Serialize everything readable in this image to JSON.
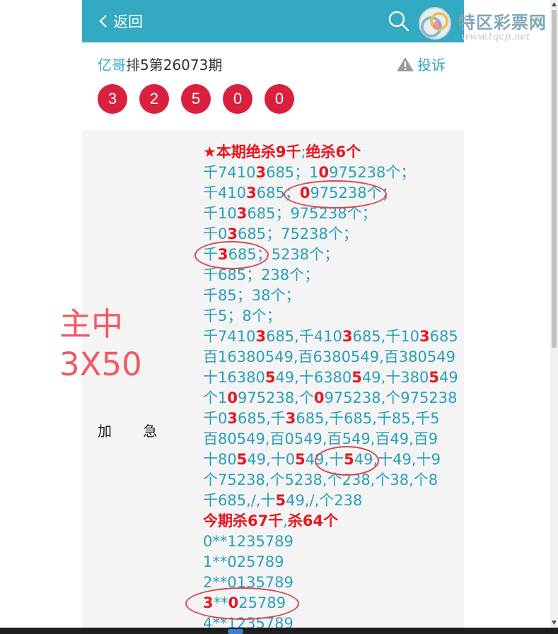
{
  "header": {
    "back_label": "返回",
    "logo_text": "特区彩票网",
    "logo_url": "www.tqcp.net",
    "bar_color": "#33a9c2"
  },
  "title": {
    "author": "亿哥",
    "text": "排5第26073期",
    "complain_label": "投诉"
  },
  "result_balls": [
    "3",
    "2",
    "5",
    "0",
    "0"
  ],
  "side": {
    "big_hit_line1": "主中",
    "big_hit_line2": "3X50",
    "urgent": "加 急"
  },
  "post_lines": [
    [
      {
        "t": "★本期绝杀9千",
        "s": "hd"
      },
      {
        "t": ";",
        "s": ""
      },
      {
        "t": "绝杀6个",
        "s": "hd"
      }
    ],
    [
      {
        "t": "千7410",
        "s": ""
      },
      {
        "t": "3",
        "s": "hl"
      },
      {
        "t": "685；1",
        "s": ""
      },
      {
        "t": "0",
        "s": "hl"
      },
      {
        "t": "975238个；",
        "s": ""
      }
    ],
    [
      {
        "t": "千410",
        "s": ""
      },
      {
        "t": "3",
        "s": "hl"
      },
      {
        "t": "685；",
        "s": ""
      },
      {
        "t": "0",
        "s": "hl"
      },
      {
        "t": "975238个；",
        "s": ""
      }
    ],
    [
      {
        "t": "千10",
        "s": ""
      },
      {
        "t": "3",
        "s": "hl"
      },
      {
        "t": "685；975238个；",
        "s": ""
      }
    ],
    [
      {
        "t": "千0",
        "s": ""
      },
      {
        "t": "3",
        "s": "hl"
      },
      {
        "t": "685；75238个；",
        "s": ""
      }
    ],
    [
      {
        "t": "千",
        "s": ""
      },
      {
        "t": "3",
        "s": "hl"
      },
      {
        "t": "685；5238个；",
        "s": ""
      }
    ],
    [
      {
        "t": "千685；238个；",
        "s": ""
      }
    ],
    [
      {
        "t": "千85；38个；",
        "s": ""
      }
    ],
    [
      {
        "t": "千5；8个；",
        "s": ""
      }
    ],
    [
      {
        "t": "千7410",
        "s": ""
      },
      {
        "t": "3",
        "s": "hl"
      },
      {
        "t": "685,千410",
        "s": ""
      },
      {
        "t": "3",
        "s": "hl"
      },
      {
        "t": "685,千10",
        "s": ""
      },
      {
        "t": "3",
        "s": "hl"
      },
      {
        "t": "685",
        "s": ""
      }
    ],
    [
      {
        "t": "百16380549,百6380549,百380549",
        "s": ""
      }
    ],
    [
      {
        "t": "十16380",
        "s": ""
      },
      {
        "t": "5",
        "s": "hl"
      },
      {
        "t": "49,十6380",
        "s": ""
      },
      {
        "t": "5",
        "s": "hl"
      },
      {
        "t": "49,十380",
        "s": ""
      },
      {
        "t": "5",
        "s": "hl"
      },
      {
        "t": "49",
        "s": ""
      }
    ],
    [
      {
        "t": "个1",
        "s": ""
      },
      {
        "t": "0",
        "s": "hl"
      },
      {
        "t": "975238,个",
        "s": ""
      },
      {
        "t": "0",
        "s": "hl"
      },
      {
        "t": "975238,个975238",
        "s": ""
      }
    ],
    [
      {
        "t": "千0",
        "s": ""
      },
      {
        "t": "3",
        "s": "hl"
      },
      {
        "t": "685,千",
        "s": ""
      },
      {
        "t": "3",
        "s": "hl"
      },
      {
        "t": "685,千685,千85,千5",
        "s": ""
      }
    ],
    [
      {
        "t": "百80549,百0549,百549,百49,百9",
        "s": ""
      }
    ],
    [
      {
        "t": "十80",
        "s": ""
      },
      {
        "t": "5",
        "s": "hl"
      },
      {
        "t": "49,十0",
        "s": ""
      },
      {
        "t": "5",
        "s": "hl"
      },
      {
        "t": "49,十",
        "s": ""
      },
      {
        "t": "5",
        "s": "hl"
      },
      {
        "t": "49,十49,十9",
        "s": ""
      }
    ],
    [
      {
        "t": "个75238,个5238,个238,个38,个8",
        "s": ""
      }
    ],
    [
      {
        "t": "千685,/,十",
        "s": ""
      },
      {
        "t": "5",
        "s": "hl"
      },
      {
        "t": "49,/,个238",
        "s": ""
      }
    ],
    [
      {
        "t": "今期杀67千",
        "s": "hd"
      },
      {
        "t": ",",
        "s": ""
      },
      {
        "t": "杀64个",
        "s": "hd"
      }
    ],
    [
      {
        "t": "0**1235789",
        "s": ""
      }
    ],
    [
      {
        "t": "1**025789",
        "s": ""
      }
    ],
    [
      {
        "t": "2**0135789",
        "s": ""
      }
    ],
    [
      {
        "t": "3",
        "s": "hl"
      },
      {
        "t": "**",
        "s": ""
      },
      {
        "t": "0",
        "s": "hl"
      },
      {
        "t": "25789",
        "s": ""
      }
    ],
    [
      {
        "t": "4**1235789",
        "s": ""
      }
    ]
  ]
}
